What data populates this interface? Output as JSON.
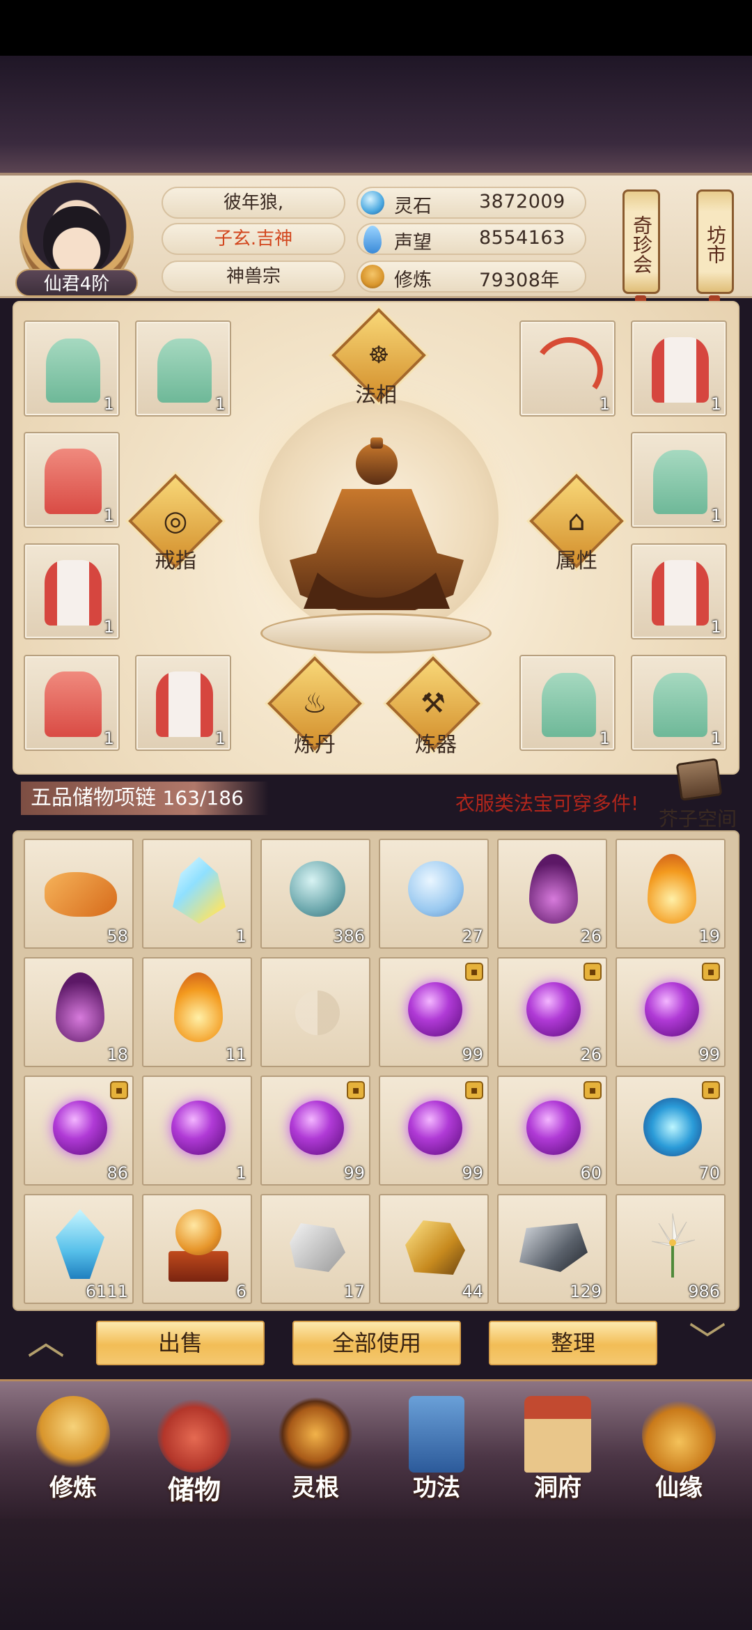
{
  "player": {
    "name": "彼年狼,",
    "title": "子玄.吉神",
    "sect": "神兽宗",
    "rank": "仙君4阶"
  },
  "resources": [
    {
      "label": "灵石",
      "value": "3872009",
      "icon": "spirit-stone-icon",
      "color": "#4aa8e0"
    },
    {
      "label": "声望",
      "value": "8554163",
      "icon": "reputation-icon",
      "color": "#3a8ad8"
    },
    {
      "label": "修炼",
      "value": "79308年",
      "icon": "cultivation-icon",
      "color": "#d8952c"
    }
  ],
  "shop_buttons": {
    "rare": "奇珍会",
    "market": "坊市"
  },
  "equipment": {
    "center_labels": {
      "faxiang": "法相",
      "ring": "戒指",
      "attribute": "属性",
      "alchemy": "炼丹",
      "forging": "炼器"
    },
    "slots": [
      {
        "item": "green-robe",
        "count": "1"
      },
      {
        "item": "green-robe",
        "count": "1"
      },
      {
        "item": "red-bow",
        "count": "1"
      },
      {
        "item": "white-red-robe",
        "count": "1"
      },
      {
        "item": "red-robe",
        "count": "1"
      },
      {
        "item": "green-robe",
        "count": "1"
      },
      {
        "item": "white-red-robe",
        "count": "1"
      },
      {
        "item": "white-red-robe",
        "count": "1"
      },
      {
        "item": "red-robe",
        "count": "1"
      },
      {
        "item": "white-red-robe",
        "count": "1"
      },
      {
        "item": "green-robe",
        "count": "1"
      },
      {
        "item": "green-robe",
        "count": "1"
      }
    ]
  },
  "bag": {
    "title": "五品储物项链",
    "capacity": "163/186",
    "hint": "衣服类法宝可穿多件!",
    "space_label": "芥子空间"
  },
  "inventory": [
    {
      "item": "orange-nugget",
      "count": "58",
      "locked": false
    },
    {
      "item": "crystal",
      "count": "1",
      "locked": false
    },
    {
      "item": "teal-orb",
      "count": "386",
      "locked": false
    },
    {
      "item": "blue-orb",
      "count": "27",
      "locked": false
    },
    {
      "item": "purple-flame",
      "count": "26",
      "locked": false
    },
    {
      "item": "orange-flame",
      "count": "19",
      "locked": false
    },
    {
      "item": "purple-flame",
      "count": "18",
      "locked": false
    },
    {
      "item": "orange-flame",
      "count": "11",
      "locked": false
    },
    {
      "item": "empty-slot",
      "count": "",
      "locked": false
    },
    {
      "item": "purple-orb",
      "count": "99",
      "locked": true
    },
    {
      "item": "purple-orb",
      "count": "26",
      "locked": true
    },
    {
      "item": "purple-orb",
      "count": "99",
      "locked": true
    },
    {
      "item": "purple-orb",
      "count": "86",
      "locked": true
    },
    {
      "item": "purple-orb",
      "count": "1",
      "locked": false
    },
    {
      "item": "purple-orb",
      "count": "99",
      "locked": true
    },
    {
      "item": "purple-orb",
      "count": "99",
      "locked": true
    },
    {
      "item": "purple-orb",
      "count": "60",
      "locked": true
    },
    {
      "item": "cyan-orb",
      "count": "70",
      "locked": true
    },
    {
      "item": "blue-shard",
      "count": "6111",
      "locked": false
    },
    {
      "item": "orb-on-stand",
      "count": "6",
      "locked": false
    },
    {
      "item": "gray-rock",
      "count": "17",
      "locked": false
    },
    {
      "item": "gold-ore",
      "count": "44",
      "locked": false
    },
    {
      "item": "dark-ore",
      "count": "129",
      "locked": false
    },
    {
      "item": "white-lily",
      "count": "986",
      "locked": false
    }
  ],
  "actions": {
    "sell": "出售",
    "use_all": "全部使用",
    "sort": "整理"
  },
  "nav": [
    {
      "label": "修炼",
      "icon": "cultivation-nav-icon"
    },
    {
      "label": "储物",
      "icon": "storage-bag-icon"
    },
    {
      "label": "灵根",
      "icon": "spirit-root-icon"
    },
    {
      "label": "功法",
      "icon": "technique-book-icon"
    },
    {
      "label": "洞府",
      "icon": "cave-dwelling-icon"
    },
    {
      "label": "仙缘",
      "icon": "gourd-icon"
    }
  ]
}
